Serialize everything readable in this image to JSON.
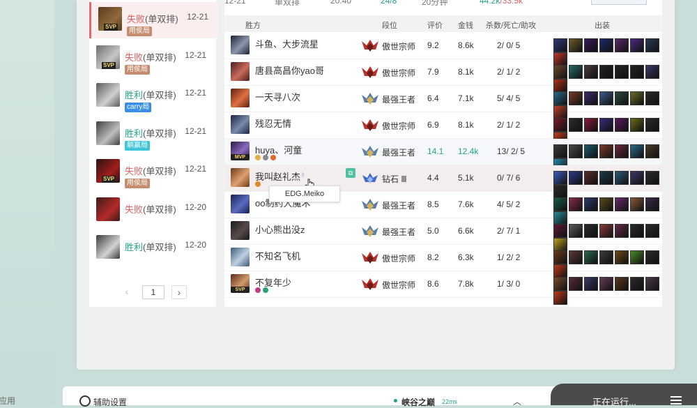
{
  "sidebar_stub": {
    "label": "应用"
  },
  "match_list": {
    "items": [
      {
        "result": "失败",
        "result_class": "lose",
        "mode": "(单双排)",
        "date": "12-21",
        "tag": "用侯局",
        "tag_class": "tag-brown",
        "badge": "SVP",
        "selected": true,
        "colors": [
          "#5b3a1c",
          "#8f6a3a"
        ]
      },
      {
        "result": "失败",
        "result_class": "lose",
        "mode": "(单双排)",
        "date": "12-21",
        "tag": "用侯局",
        "tag_class": "tag-brown",
        "badge": "SVP",
        "selected": false,
        "colors": [
          "#6d6d6d",
          "#c7c7c7"
        ]
      },
      {
        "result": "胜利",
        "result_class": "win",
        "mode": "(单双排)",
        "date": "12-21",
        "tag": "carry局",
        "tag_class": "tag-blue",
        "badge": "",
        "selected": false,
        "colors": [
          "#5b5b5b",
          "#cfcfcf"
        ]
      },
      {
        "result": "胜利",
        "result_class": "win",
        "mode": "(单双排)",
        "date": "12-21",
        "tag": "躺赢局",
        "tag_class": "tag-cyan",
        "badge": "",
        "selected": false,
        "colors": [
          "#404040",
          "#bdbdbd"
        ]
      },
      {
        "result": "失败",
        "result_class": "lose",
        "mode": "(单双排)",
        "date": "12-21",
        "tag": "用侯局",
        "tag_class": "tag-brown",
        "badge": "SVP",
        "selected": false,
        "colors": [
          "#2a1313",
          "#a11d1d"
        ]
      },
      {
        "result": "失败",
        "result_class": "lose",
        "mode": "(单双排)",
        "date": "12-20",
        "tag": "",
        "tag_class": "",
        "badge": "",
        "selected": false,
        "colors": [
          "#3c1b1b",
          "#b42a2a"
        ]
      },
      {
        "result": "胜利",
        "result_class": "win",
        "mode": "(单双排)",
        "date": "12-20",
        "tag": "",
        "tag_class": "",
        "badge": "",
        "selected": false,
        "colors": [
          "#3b3b3b",
          "#d2d2d2"
        ]
      }
    ],
    "pager": {
      "prev": "‹",
      "page": "1",
      "next": "›"
    }
  },
  "summary_row": {
    "date": "12-21",
    "mode": "单双排",
    "time": "20:40",
    "kda": "24/8",
    "duration": "20分钟",
    "gold_a": "44.2k",
    "gold_sep": "/",
    "gold_b": "33.5k"
  },
  "table_header": {
    "team": "胜方",
    "rank": "段位",
    "score": "评价",
    "gold": "金钱",
    "kda": "杀数/死亡/助攻",
    "items": "出装"
  },
  "players": [
    {
      "name": "斗鱼、大步流星",
      "rank": "傲世宗师",
      "rank_type": "gm",
      "score": "9.2",
      "gold": "8.6k",
      "kda": "2/ 0/ 5",
      "badge": "",
      "mini": [],
      "avatar": [
        "#1d2230",
        "#8c97ad"
      ],
      "items": [
        "#2d3a7a",
        "#6b5a2b",
        "#3a1b5c",
        "#1c2a6a",
        "#5a2a6a",
        "#4a2a82",
        "#2a3a5a",
        "#c0392b"
      ]
    },
    {
      "name": "唐县高昌你yao哥",
      "rank": "傲世宗师",
      "rank_type": "gm",
      "score": "7.9",
      "gold": "8.1k",
      "kda": "2/ 1/ 2",
      "badge": "",
      "mini": [],
      "avatar": [
        "#4a2020",
        "#c96a5a"
      ],
      "items": [
        "#6a4a2a",
        "#2a6a6a",
        "#4a3a3a",
        "#222222",
        "#222222",
        "#222222",
        "#3a3a6a",
        "#b0301a"
      ]
    },
    {
      "name": "一天寻八次",
      "rank": "最强王者",
      "rank_type": "ch",
      "score": "6.4",
      "gold": "7.1k",
      "kda": "5/ 4/ 5",
      "badge": "",
      "mini": [],
      "avatar": [
        "#5a2010",
        "#e07040"
      ],
      "items": [
        "#2a6a8a",
        "#7a3a2a",
        "#3a2a6a",
        "#3a5a8a",
        "#2a4a3a",
        "#6a6a2a",
        "#2a2a2a",
        "#c0402a"
      ]
    },
    {
      "name": "残忍无情",
      "rank": "傲世宗师",
      "rank_type": "gm",
      "score": "6.9",
      "gold": "8.1k",
      "kda": "2/ 1/ 2",
      "badge": "",
      "mini": [],
      "avatar": [
        "#1a2540",
        "#7a8aaa"
      ],
      "items": [
        "#7a1a2a",
        "#2a2a2a",
        "#8a1a3a",
        "#3a2a7a",
        "#5a1a5a",
        "#6a6a1a",
        "#2a2a2a",
        "#c04020"
      ]
    },
    {
      "name": "huya、河童",
      "rank": "最强王者",
      "rank_type": "ch",
      "score": "14.1",
      "gold": "12.4k",
      "kda": "13/ 2/ 5",
      "badge": "MVP",
      "mini": [
        "#e0b040",
        "#888888",
        "#e06a2a"
      ],
      "avatar": [
        "#2a1a40",
        "#8a6ac0"
      ],
      "items": [
        "#3a3a3a",
        "#4a4a4a",
        "#1a5a6a",
        "#7a3a2a",
        "#6a2a3a",
        "#2a6a8a",
        "#4a3a2a",
        "#2a8aaa"
      ],
      "green": true
    },
    {
      "name": "我叫赵礼杰",
      "rank": "钻石 Ⅲ",
      "rank_type": "dia",
      "score": "4.4",
      "gold": "5.1k",
      "kda": "0/ 7/ 6",
      "badge": "",
      "mini": [
        "#e08a2a"
      ],
      "avatar": [
        "#6a3a1a",
        "#e0a070"
      ],
      "items": [
        "#3a5ac0",
        "#2a3a8a",
        "#5a2a2a",
        "#1a3a4a",
        "#2a5a7a",
        "#3a3a6a",
        "#2a2a2a",
        "#2a2a2a"
      ],
      "hover": true
    },
    {
      "name": "oo制药大魔术",
      "rank": "最强王者",
      "rank_type": "ch",
      "score": "8.5",
      "gold": "7.6k",
      "kda": "4/ 5/ 2",
      "badge": "",
      "mini": [],
      "avatar": [
        "#1a2050",
        "#5a6ac0"
      ],
      "items": [
        "#1a5a4a",
        "#8a2a4a",
        "#2a3a6a",
        "#5a4a1a",
        "#6a2a6a",
        "#8a5a3a",
        "#3a2a4a",
        "#2a8a9a"
      ]
    },
    {
      "name": "小心熊出没z",
      "rank": "最强王者",
      "rank_type": "ch",
      "score": "5.0",
      "gold": "6.6k",
      "kda": "2/ 7/ 1",
      "badge": "",
      "mini": [],
      "avatar": [
        "#1a1a1a",
        "#5a4a4a"
      ],
      "items": [
        "#5a1a3a",
        "#5a5a5a",
        "#2a2a2a",
        "#8a3a3a",
        "#6a2a4a",
        "#2a2a2a",
        "#2a2a2a",
        "#c0a020"
      ]
    },
    {
      "name": "不知名飞机",
      "rank": "傲世宗师",
      "rank_type": "gm",
      "score": "8.2",
      "gold": "6.3k",
      "kda": "1/ 2/ 2",
      "badge": "",
      "mini": [],
      "avatar": [
        "#3a5a7a",
        "#c0d0e0"
      ],
      "items": [
        "#6a3a1a",
        "#5a3a3a",
        "#2a6a4a",
        "#3a3a3a",
        "#6a4a1a",
        "#4a8a2a",
        "#2a2a2a",
        "#c03a1a"
      ]
    },
    {
      "name": "不复年少",
      "rank": "傲世宗师",
      "rank_type": "gm",
      "score": "8.6",
      "gold": "7.8k",
      "kda": "1/ 3/ 0",
      "badge": "SVP",
      "mini": [
        "#c03a8a",
        "#2aa07a"
      ],
      "avatar": [
        "#5a2a1a",
        "#d09a6a"
      ],
      "items": [
        "#7a4a2a",
        "#5a2a3a",
        "#3a3a6a",
        "#6a3a5a",
        "#5a3a1a",
        "#2a2a2a",
        "#4a3a4a",
        "#c03a1a"
      ]
    }
  ],
  "tooltip": {
    "text": "EDG.Meiko"
  },
  "bottom_bar": {
    "settings_label": "辅助设置",
    "server": "峡谷之巅",
    "ping": "22ms",
    "running": "正在运行..."
  }
}
